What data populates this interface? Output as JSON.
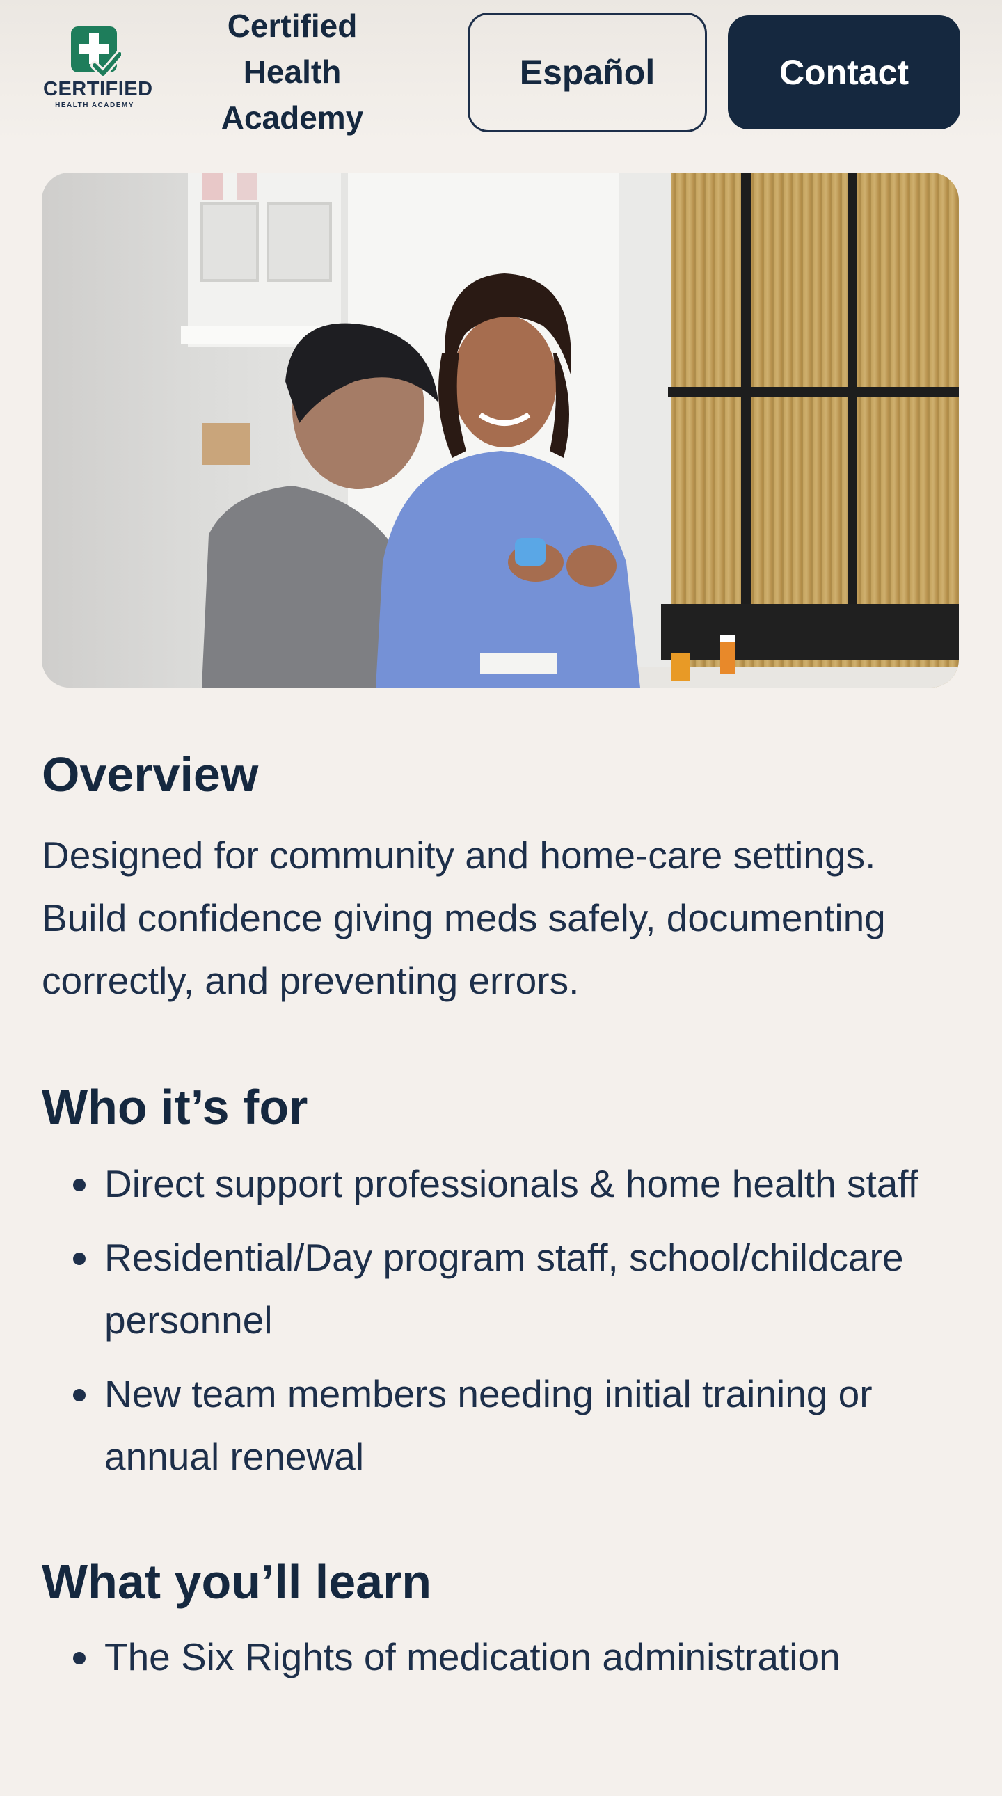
{
  "header": {
    "logo": {
      "wordmark": "CERTIFIED",
      "sub": "HEALTH ACADEMY",
      "icon": "medical-cross-check-icon",
      "colors": {
        "green": "#1e7d5b",
        "navy": "#1d2f4a"
      }
    },
    "brand_name": "Certified Health Academy",
    "language_button": "Español",
    "contact_button": "Contact"
  },
  "hero": {
    "alt": "Nurse in blue scrubs showing a medication inhaler to an older man at a table"
  },
  "overview": {
    "heading": "Overview",
    "text": "Designed for community and home-care settings. Build confidence giving meds safely, documenting correctly, and preventing errors."
  },
  "who": {
    "heading": "Who it’s for",
    "items": [
      "Direct support professionals & home health staff",
      "Residential/Day program staff, school/childcare personnel",
      "New team members needing initial training or annual renewal"
    ]
  },
  "learn": {
    "heading": "What you’ll learn",
    "items": [
      "The Six Rights of medication administration"
    ]
  },
  "colors": {
    "background": "#f4f0ec",
    "navy": "#15283f"
  }
}
